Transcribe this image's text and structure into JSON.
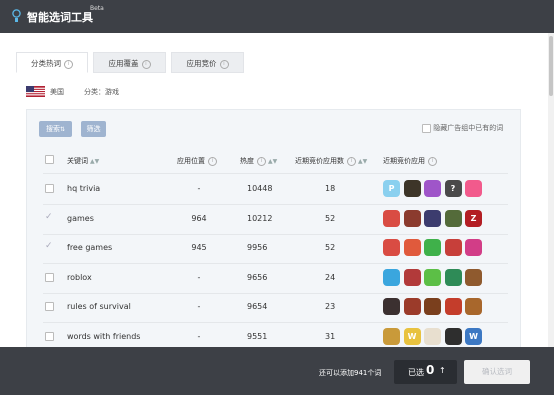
{
  "app": {
    "title": "智能选词工具",
    "badge": "Beta"
  },
  "tabs": [
    {
      "label": "分类热词",
      "active": true
    },
    {
      "label": "应用覆盖",
      "active": false
    },
    {
      "label": "应用竞价",
      "active": false
    }
  ],
  "filter": {
    "country": "美国",
    "category": "分类：游戏"
  },
  "toolbar": {
    "search_label": "搜索",
    "filter_label": "筛选",
    "hide_option": "隐藏广告组中已有的词"
  },
  "table": {
    "headers": [
      "关键词",
      "应用位置",
      "热度",
      "近期竞价应用数",
      "近期竞价应用"
    ],
    "rows": [
      {
        "checked": false,
        "keyword": "hq trivia",
        "position": "-",
        "heat": "10448",
        "bid_count": "18",
        "apps": [
          {
            "name": "app-p",
            "color": "#8ad0ef",
            "glyph": "P"
          },
          {
            "name": "app-zombie",
            "color": "#3d3528",
            "glyph": ""
          },
          {
            "name": "app-girl",
            "color": "#9f55c9",
            "glyph": ""
          },
          {
            "name": "app-question",
            "color": "#4a4a4a",
            "glyph": "?"
          },
          {
            "name": "app-bulb",
            "color": "#f25a8c",
            "glyph": ""
          }
        ]
      },
      {
        "checked": true,
        "keyword": "games",
        "position": "964",
        "heat": "10212",
        "bid_count": "52",
        "apps": [
          {
            "name": "app-cars",
            "color": "#d94c43",
            "glyph": ""
          },
          {
            "name": "app-pixel",
            "color": "#8b3b2e",
            "glyph": ""
          },
          {
            "name": "app-racing",
            "color": "#3c3c6e",
            "glyph": ""
          },
          {
            "name": "app-soldier",
            "color": "#546b3a",
            "glyph": ""
          },
          {
            "name": "app-z",
            "color": "#b31e24",
            "glyph": "Z"
          }
        ]
      },
      {
        "checked": true,
        "keyword": "free games",
        "position": "945",
        "heat": "9956",
        "bid_count": "52",
        "apps": [
          {
            "name": "app-cars",
            "color": "#d94c43",
            "glyph": ""
          },
          {
            "name": "app-robot",
            "color": "#e05a3c",
            "glyph": ""
          },
          {
            "name": "app-hero",
            "color": "#3fb14a",
            "glyph": ""
          },
          {
            "name": "app-face",
            "color": "#c73f3a",
            "glyph": ""
          },
          {
            "name": "app-pink",
            "color": "#d23d87",
            "glyph": ""
          }
        ]
      },
      {
        "checked": false,
        "keyword": "roblox",
        "position": "-",
        "heat": "9656",
        "bid_count": "24",
        "apps": [
          {
            "name": "app-balls",
            "color": "#3aa6de",
            "glyph": ""
          },
          {
            "name": "app-fighter",
            "color": "#b23a3a",
            "glyph": ""
          },
          {
            "name": "app-green",
            "color": "#5cbf46",
            "glyph": ""
          },
          {
            "name": "app-hero2",
            "color": "#2e8b57",
            "glyph": ""
          },
          {
            "name": "app-brick",
            "color": "#8f5a2e",
            "glyph": ""
          }
        ]
      },
      {
        "checked": false,
        "keyword": "rules of survival",
        "position": "-",
        "heat": "9654",
        "bid_count": "23",
        "apps": [
          {
            "name": "app-dark",
            "color": "#3b3030",
            "glyph": ""
          },
          {
            "name": "app-warrior",
            "color": "#9b3b2a",
            "glyph": ""
          },
          {
            "name": "app-chest",
            "color": "#7a3f1d",
            "glyph": ""
          },
          {
            "name": "app-target",
            "color": "#c43d2b",
            "glyph": ""
          },
          {
            "name": "app-crate",
            "color": "#a8672c",
            "glyph": ""
          }
        ]
      },
      {
        "checked": false,
        "keyword": "words with friends",
        "position": "-",
        "heat": "9551",
        "bid_count": "31",
        "apps": [
          {
            "name": "app-word",
            "color": "#c99a3a",
            "glyph": ""
          },
          {
            "name": "app-w",
            "color": "#e8c23f",
            "glyph": "W"
          },
          {
            "name": "app-dice",
            "color": "#e8dfcf",
            "glyph": ""
          },
          {
            "name": "app-dark2",
            "color": "#2e2e2e",
            "glyph": ""
          },
          {
            "name": "app-w2",
            "color": "#3c78c3",
            "glyph": "W"
          }
        ]
      }
    ]
  },
  "footer": {
    "remaining": "还可以添加941个词",
    "selected_label": "已选",
    "selected_count": "0",
    "confirm_label": "确认选词"
  }
}
